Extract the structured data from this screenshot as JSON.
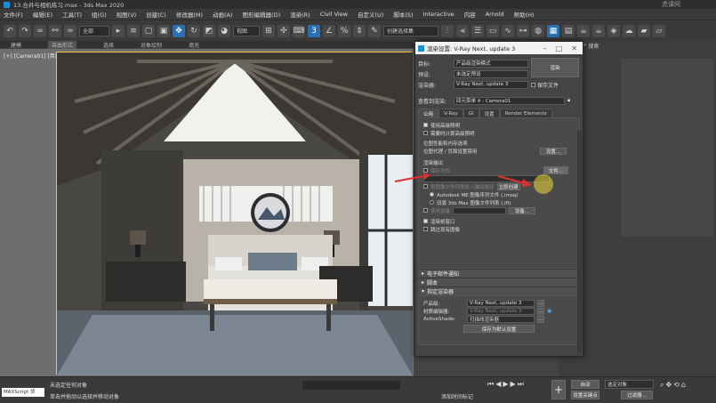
{
  "window": {
    "title": "13.合并与相机练习.max - 3ds Max 2020"
  },
  "menu": [
    "文件(F)",
    "编辑(E)",
    "工具(T)",
    "组(G)",
    "视图(V)",
    "创建(C)",
    "修改器(M)",
    "动画(A)",
    "图形编辑器(D)",
    "渲染(R)",
    "Civil View",
    "自定义(U)",
    "脚本(S)",
    "Interactive",
    "内容",
    "Arnold",
    "帮助(H)"
  ],
  "toolbar": {
    "filter": "全部",
    "ref_coord": "视图",
    "selection_set": "创建选择集"
  },
  "ribbon": {
    "tabs": [
      "建模",
      "自由形式",
      "选择",
      "对象绘制",
      "填充"
    ],
    "active": "自由形式"
  },
  "viewport": {
    "label": "[+] [Camera01] [用户定义] [默认明暗处理]"
  },
  "right_panel": {
    "search_label": "搜索"
  },
  "dialog": {
    "title": "渲染设置: V-Ray Next, update 3",
    "target_label": "目标:",
    "target_value": "产品级渲染模式",
    "preset_label": "预设:",
    "preset_value": "未选定预设",
    "renderer_label": "渲染器:",
    "renderer_value": "V-Ray Next, update 3",
    "save_file_label": "保存文件",
    "view_label": "查看到渲染:",
    "view_value": "四元菜单 4 - Camera01",
    "render_button": "渲染",
    "tabs": [
      "公用",
      "V-Ray",
      "GI",
      "设置",
      "Render Elements"
    ],
    "active_tab": "公用",
    "opts": {
      "advanced_lighting": "使用高级照明",
      "compute_advanced": "需要时计算高级照明",
      "bitmap_perf": "位图性能和内存选项",
      "bitmap_proxy": "位图代理 / 页面设置禁用",
      "setup_button": "设置...",
      "render_output": "渲染输出",
      "save_file": "保存文件",
      "files_button": "文件...",
      "put_image": "将图像文件列表放入输出路径",
      "create_now": "立即创建",
      "autodesk_seq": "Autodesk ME 图像序列文件 (.imsq)",
      "legacy_seq": "旧版 3ds Max 图像文件列表 (.ifl)",
      "use_device": "使用设备",
      "devices_button": "设备...",
      "render_frame_window": "渲染帧窗口",
      "skip_existing": "跳过现有图像"
    },
    "rollouts": {
      "email": "电子邮件通知",
      "scripts": "脚本",
      "assign_renderer": "指定渲染器"
    },
    "assign": {
      "production_label": "产品级:",
      "production_value": "V-Ray Next, update 3",
      "material_label": "材质编辑器:",
      "material_value": "V-Ray Next, update 3",
      "activeshade_label": "ActiveShade:",
      "activeshade_value": "扫描线渲染器",
      "save_default": "保存为默认设置"
    }
  },
  "status": {
    "maxscript": "MAXScript 侦",
    "line1": "未选定任何对象",
    "line2": "单击并拖动以选择并移动对象",
    "add_time_tag": "添加时间标记",
    "auto_key": "自动",
    "selected_object": "选定对象",
    "set_key": "设置关键点",
    "key_filter": "过滤器..."
  },
  "watermark": "虎课网"
}
